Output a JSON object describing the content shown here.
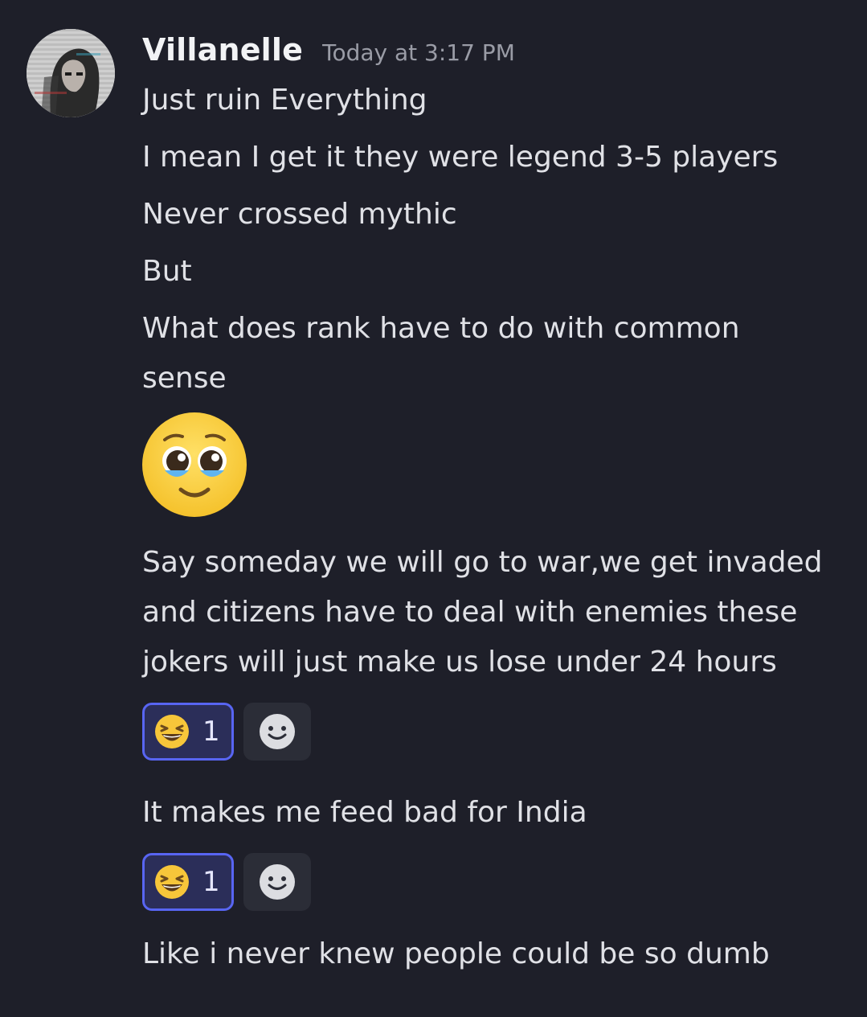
{
  "message": {
    "author": "Villanelle",
    "timestamp": "Today at 3:17 PM",
    "avatar_icon": "user-avatar",
    "lines": {
      "l1": "Just ruin Everything",
      "l2": "I mean I get it they were legend 3-5 players",
      "l3": "Never crossed mythic",
      "l4": "But",
      "l5a": "What does rank have to do with common",
      "l5b": "sense",
      "l7a": "Say someday we will go to war,we get invaded",
      "l7b": "and citizens have to deal with enemies these",
      "l7c": "jokers will just make us lose under 24 hours",
      "l8": "It makes me feed bad for India",
      "l9": "Like i never knew people could be so dumb"
    },
    "big_emoji": "pleading-face-emoji",
    "reaction_groups": [
      {
        "reaction": {
          "emoji": "laughing-face-emoji",
          "count": "1",
          "selected": true
        },
        "add_reaction_icon": "add-reaction-smiley-icon"
      },
      {
        "reaction": {
          "emoji": "laughing-face-emoji",
          "count": "1",
          "selected": true
        },
        "add_reaction_icon": "add-reaction-smiley-icon"
      }
    ]
  },
  "colors": {
    "background": "#1e1f29",
    "text": "#e0e1e6",
    "username": "#f2f3f5",
    "timestamp": "#9a9ca6",
    "reaction_selected_bg": "#2b2e59",
    "reaction_selected_border": "#5865f2",
    "add_reaction_bg": "#2b2d37"
  }
}
